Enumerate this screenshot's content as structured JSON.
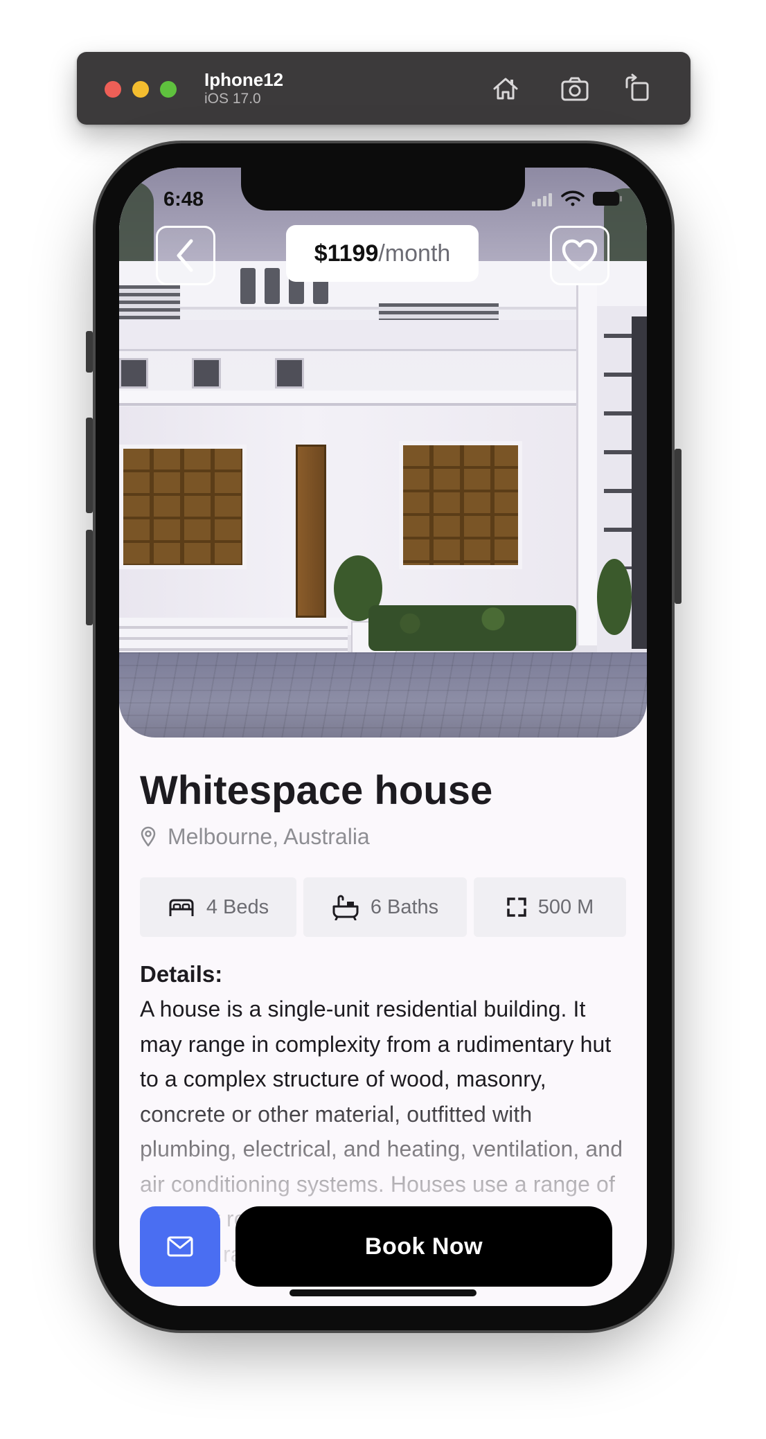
{
  "simulator": {
    "device_name": "Iphone12",
    "os_version": "iOS 17.0",
    "toolbar_icons": [
      "home-icon",
      "screenshot-icon",
      "rotate-icon"
    ]
  },
  "status_bar": {
    "time": "6:48",
    "icons": [
      "signal-icon",
      "wifi-icon",
      "battery-icon"
    ]
  },
  "hero": {
    "price_amount": "$1199",
    "price_period": "/month",
    "icons": [
      "chevron-left-icon",
      "heart-icon"
    ]
  },
  "property": {
    "title": "Whitespace house",
    "location": "Melbourne, Australia",
    "features": [
      {
        "icon": "bed-icon",
        "label": "4 Beds"
      },
      {
        "icon": "bath-icon",
        "label": "6 Baths"
      },
      {
        "icon": "area-icon",
        "label": "500 M"
      }
    ],
    "details_heading": "Details:",
    "details_text": "A house is a single-unit residential building. It may range in complexity from a rudimentary hut to a complex structure of wood, masonry, concrete or other material, outfitted with plumbing, electrical, and heating, ventilation, and air conditioning systems. Houses use a range of different roofing systems to keep precipitation such as rain from"
  },
  "actions": {
    "mail_icon": "mail-icon",
    "book_label": "Book Now"
  },
  "colors": {
    "accent": "#4a6ef2",
    "book_button": "#000000",
    "background": "#fbf8fc"
  }
}
